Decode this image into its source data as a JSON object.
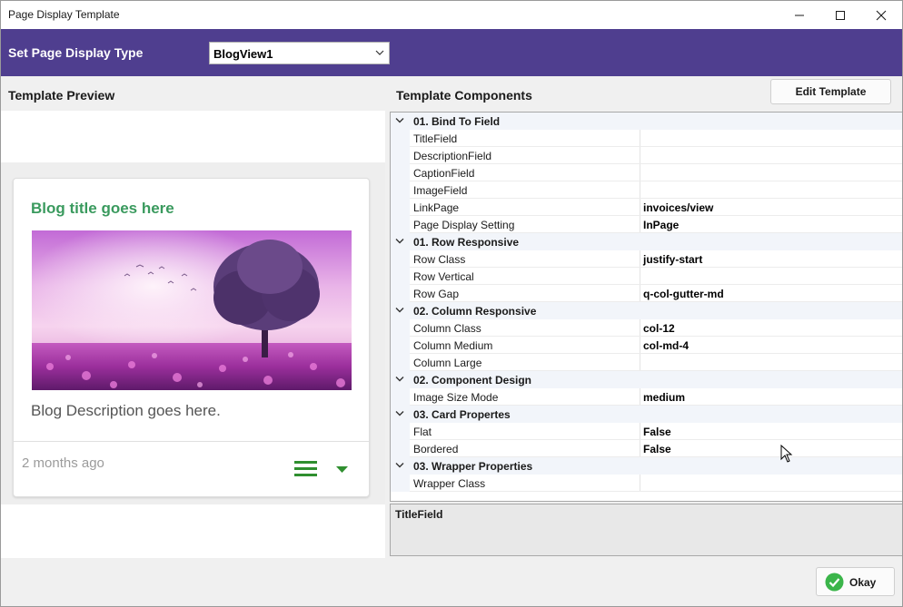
{
  "window": {
    "title": "Page Display Template",
    "controls": [
      "minimize",
      "maximize",
      "close"
    ]
  },
  "header": {
    "label": "Set Page Display Type",
    "select_value": "BlogView1",
    "background": "#4f3e8f"
  },
  "preview": {
    "heading": "Template Preview",
    "card": {
      "title": "Blog title goes here",
      "title_color": "#3a9a5e",
      "image": "purple-tree-landscape",
      "description": "Blog Description goes here.",
      "time": "2 months ago",
      "menu_icon": "hamburger-menu-icon",
      "dropdown_icon": "caret-down-icon",
      "accent_color": "#2f8f2f"
    }
  },
  "components": {
    "heading": "Template Components",
    "edit_button": "Edit Template",
    "rows": [
      {
        "type": "category",
        "name": "01. Bind To Field"
      },
      {
        "type": "prop",
        "name": "TitleField",
        "value": ""
      },
      {
        "type": "prop",
        "name": "DescriptionField",
        "value": ""
      },
      {
        "type": "prop",
        "name": "CaptionField",
        "value": ""
      },
      {
        "type": "prop",
        "name": "ImageField",
        "value": ""
      },
      {
        "type": "prop",
        "name": "LinkPage",
        "value": "invoices/view"
      },
      {
        "type": "prop",
        "name": "Page Display Setting",
        "value": "InPage"
      },
      {
        "type": "category",
        "name": "01. Row Responsive"
      },
      {
        "type": "prop",
        "name": "Row Class",
        "value": "justify-start"
      },
      {
        "type": "prop",
        "name": "Row Vertical",
        "value": ""
      },
      {
        "type": "prop",
        "name": "Row Gap",
        "value": "q-col-gutter-md"
      },
      {
        "type": "category",
        "name": "02. Column Responsive"
      },
      {
        "type": "prop",
        "name": "Column Class",
        "value": "col-12"
      },
      {
        "type": "prop",
        "name": "Column Medium",
        "value": "col-md-4"
      },
      {
        "type": "prop",
        "name": "Column Large",
        "value": ""
      },
      {
        "type": "category",
        "name": "02. Component Design"
      },
      {
        "type": "prop",
        "name": "Image Size Mode",
        "value": "medium"
      },
      {
        "type": "category",
        "name": "03. Card Propertes"
      },
      {
        "type": "prop",
        "name": "Flat",
        "value": "False"
      },
      {
        "type": "prop",
        "name": "Bordered",
        "value": "False"
      },
      {
        "type": "category",
        "name": "03. Wrapper Properties"
      },
      {
        "type": "prop",
        "name": "Wrapper Class",
        "value": ""
      }
    ],
    "description_title": "TitleField"
  },
  "footer": {
    "ok_label": "Okay",
    "ok_icon": "check-circle-icon"
  }
}
